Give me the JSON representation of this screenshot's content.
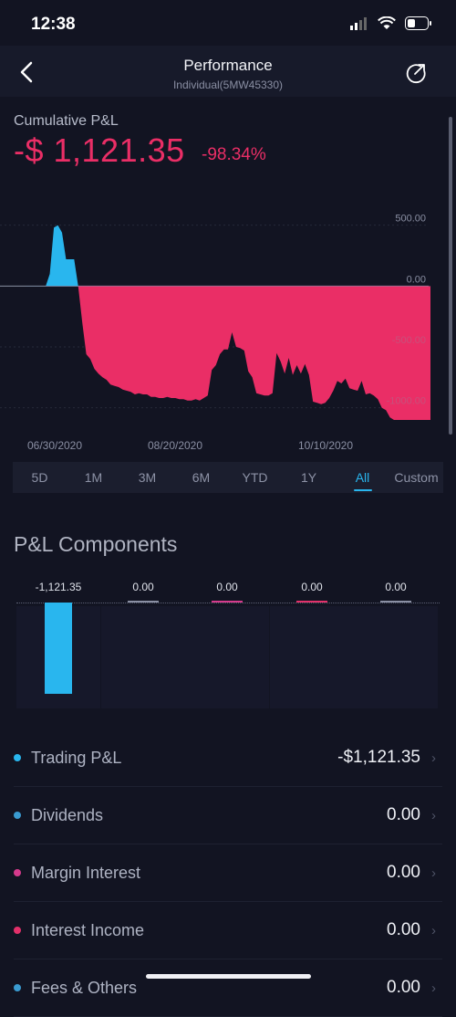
{
  "status": {
    "time": "12:38"
  },
  "header": {
    "title": "Performance",
    "subtitle": "Individual(5MW45330)"
  },
  "cumulative": {
    "label": "Cumulative P&L",
    "value": "-$ 1,121.35",
    "percent": "-98.34%"
  },
  "chart_data": {
    "type": "area",
    "x_labels": [
      "06/30/2020",
      "08/20/2020",
      "10/10/2020"
    ],
    "y_ticks": [
      "500.00",
      "0.00",
      "-500.00",
      "-1000.00"
    ],
    "ylim": [
      -1100,
      550
    ],
    "colors": {
      "positive": "#29b6ee",
      "negative": "#ea2e66"
    },
    "values": [
      0,
      0,
      0,
      0,
      0,
      0,
      100,
      480,
      500,
      440,
      220,
      220,
      220,
      0,
      -300,
      -560,
      -600,
      -680,
      -720,
      -750,
      -770,
      -810,
      -820,
      -830,
      -850,
      -860,
      -870,
      -890,
      -880,
      -890,
      -890,
      -910,
      -910,
      -920,
      -920,
      -910,
      -920,
      -920,
      -930,
      -930,
      -940,
      -940,
      -930,
      -940,
      -920,
      -900,
      -690,
      -650,
      -560,
      -520,
      -520,
      -380,
      -500,
      -510,
      -530,
      -700,
      -750,
      -880,
      -890,
      -900,
      -900,
      -880,
      -550,
      -620,
      -720,
      -590,
      -730,
      -650,
      -720,
      -640,
      -730,
      -950,
      -960,
      -970,
      -960,
      -920,
      -860,
      -780,
      -800,
      -760,
      -840,
      -850,
      -860,
      -780,
      -890,
      -880,
      -900,
      -930,
      -1000,
      -1020,
      -1080,
      -1100,
      -1100,
      -1100,
      -1100,
      -1100,
      -1100,
      -1100,
      -1100,
      -1100,
      -1100
    ]
  },
  "ranges": [
    {
      "label": "5D",
      "active": false
    },
    {
      "label": "1M",
      "active": false
    },
    {
      "label": "3M",
      "active": false
    },
    {
      "label": "6M",
      "active": false
    },
    {
      "label": "YTD",
      "active": false
    },
    {
      "label": "1Y",
      "active": false
    },
    {
      "label": "All",
      "active": true
    },
    {
      "label": "Custom",
      "active": false
    }
  ],
  "components": {
    "title": "P&L Components",
    "bars": [
      {
        "label": "-1,121.35",
        "value": -1121.35,
        "color": "#29b6ee"
      },
      {
        "label": "0.00",
        "value": 0,
        "color": "#8a8fa3"
      },
      {
        "label": "0.00",
        "value": 0,
        "color": "#d53a8c"
      },
      {
        "label": "0.00",
        "value": 0,
        "color": "#e2306a"
      },
      {
        "label": "0.00",
        "value": 0,
        "color": "#8a8fa3"
      }
    ]
  },
  "rows": [
    {
      "label": "Trading P&L",
      "value": "-$1,121.35",
      "color": "#29b6ee"
    },
    {
      "label": "Dividends",
      "value": "0.00",
      "color": "#3a9bd1"
    },
    {
      "label": "Margin Interest",
      "value": "0.00",
      "color": "#d53a8c"
    },
    {
      "label": "Interest Income",
      "value": "0.00",
      "color": "#e2306a"
    },
    {
      "label": "Fees & Others",
      "value": "0.00",
      "color": "#3a9bd1"
    }
  ]
}
